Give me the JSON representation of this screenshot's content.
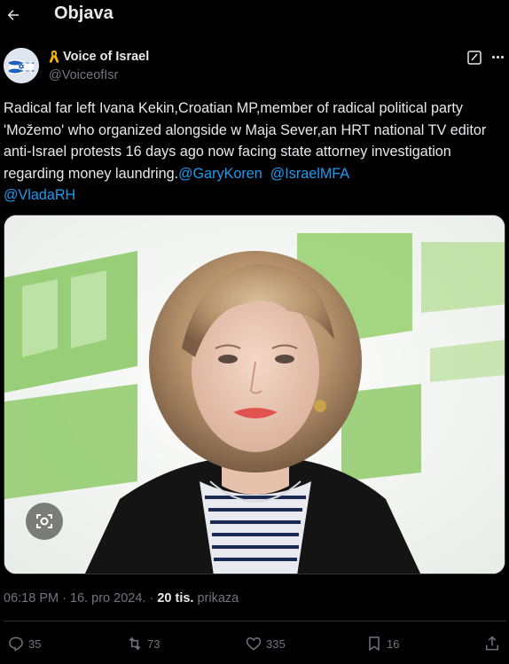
{
  "header": {
    "title": "Objava"
  },
  "author": {
    "display_name": "Voice of Israel",
    "handle": "@VoiceofIsr"
  },
  "tweet": {
    "text_segments": [
      "Radical far left Ivana Kekin,Croatian MP,member of radical political party 'Možemo' who organized alongside w Maja Sever,an HRT national  TV editor anti-Israel protests 16 days ago now facing state attorney investigation regarding money laundring.",
      "@GaryKoren",
      "@IsraelMFA",
      "@VladaRH"
    ]
  },
  "meta": {
    "time": "06:18 PM",
    "separator1": " · ",
    "date": "16. pro 2024.",
    "separator2": " · ",
    "views_count": "20 tis.",
    "views_label": "prikaza"
  },
  "actions": {
    "replies": "35",
    "reposts": "73",
    "likes": "335",
    "bookmarks": "16"
  },
  "colors": {
    "accent": "#1d9bf0",
    "background": "#000000",
    "muted": "#71767b",
    "text": "#e7e9ea"
  },
  "icons": [
    "back-arrow-icon",
    "yellow-ribbon-icon",
    "edit-icon",
    "more-icon",
    "lens-icon",
    "reply-icon",
    "repost-icon",
    "like-icon",
    "bookmark-icon",
    "share-icon"
  ]
}
